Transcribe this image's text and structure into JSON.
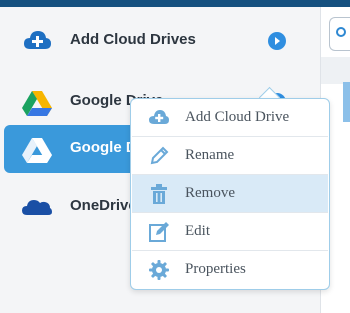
{
  "sidebar": {
    "items": [
      {
        "label": "Add Cloud Drives",
        "icon": "cloud-plus-icon"
      },
      {
        "label": "Google Drive",
        "icon": "google-drive-icon"
      },
      {
        "label": "Google Drive",
        "icon": "google-drive-white-icon",
        "selected": true
      },
      {
        "label": "OneDrive",
        "icon": "onedrive-icon"
      }
    ]
  },
  "context_menu": {
    "items": [
      {
        "label": "Add Cloud Drive",
        "icon": "cloud-plus-icon"
      },
      {
        "label": "Rename",
        "icon": "pencil-icon"
      },
      {
        "label": "Remove",
        "icon": "trash-icon",
        "highlighted": true
      },
      {
        "label": "Edit",
        "icon": "edit-icon"
      },
      {
        "label": "Properties",
        "icon": "gear-icon"
      }
    ]
  },
  "colors": {
    "accent": "#3a99db",
    "menu_highlight": "#d9eaf7",
    "icon_blue": "#6aa9d8"
  }
}
